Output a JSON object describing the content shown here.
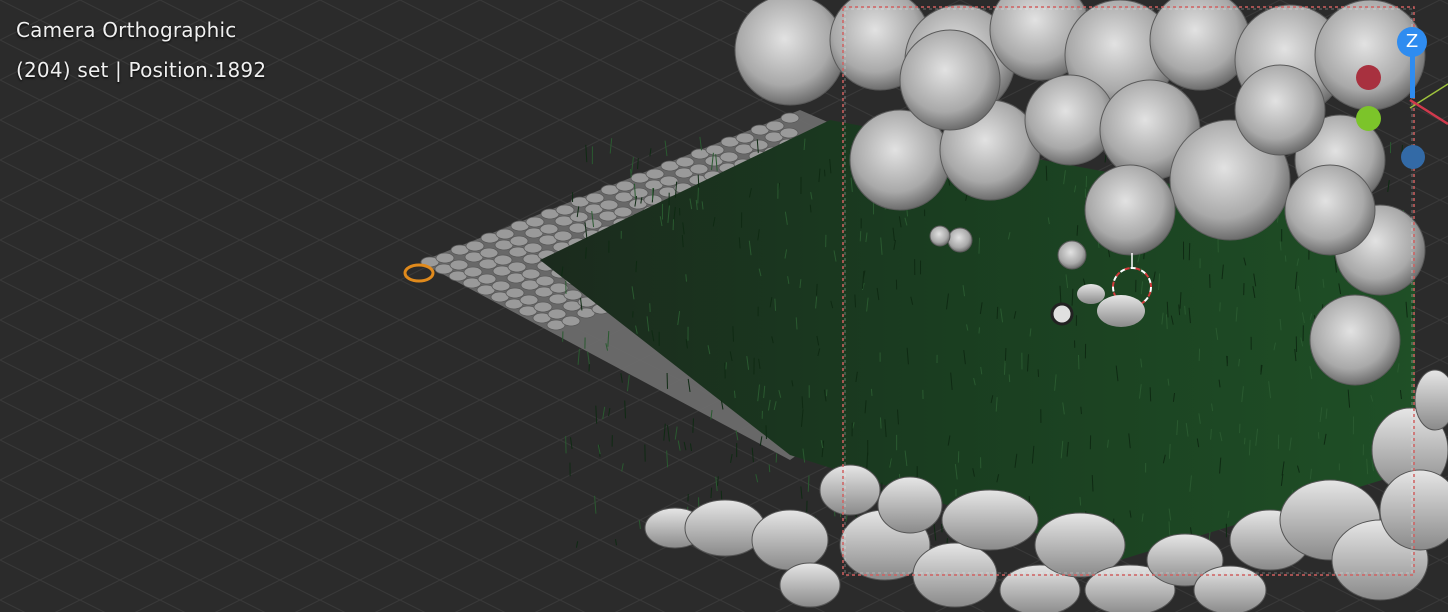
{
  "viewport": {
    "mode_label": "Camera Orthographic",
    "object_label": "(204) set | Position.1892"
  },
  "gizmo": {
    "z_label": "Z"
  },
  "colors": {
    "background": "#2b2b2b",
    "grass": "#1e4a24",
    "tree": "#bfbfbf",
    "rock": "#d0d0d0",
    "camera_border": "#d06060",
    "axis_x": "#a8313f",
    "axis_y": "#7cc42a",
    "axis_z": "#2f8cf0"
  }
}
